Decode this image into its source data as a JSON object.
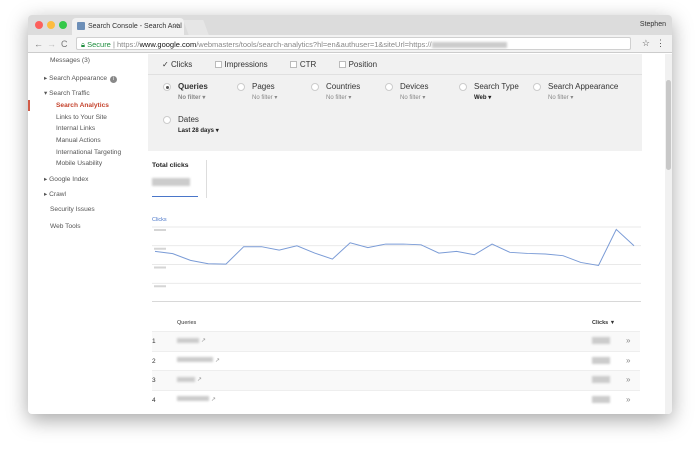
{
  "browser": {
    "tab_title": "Search Console - Search Anal",
    "user": "Stephen",
    "secure_label": "Secure",
    "url_prefix": "https://",
    "url_domain": "www.google.com",
    "url_path": "/webmasters/tools/search-analytics?hl=en&authuser=1&siteUrl=https://"
  },
  "sidebar": {
    "items": [
      {
        "label": "Messages (3)"
      },
      {
        "label": "Search Appearance"
      },
      {
        "label": "Search Traffic"
      },
      {
        "label": "Search Analytics"
      },
      {
        "label": "Links to Your Site"
      },
      {
        "label": "Internal Links"
      },
      {
        "label": "Manual Actions"
      },
      {
        "label": "International Targeting"
      },
      {
        "label": "Mobile Usability"
      },
      {
        "label": "Google Index"
      },
      {
        "label": "Crawl"
      },
      {
        "label": "Security Issues"
      },
      {
        "label": "Web Tools"
      }
    ],
    "active": "Search Analytics",
    "accent": "#c5442e"
  },
  "metrics": {
    "clicks": "Clicks",
    "impressions": "Impressions",
    "ctr": "CTR",
    "position": "Position",
    "clicks_checked": true
  },
  "dimensions": [
    {
      "label": "Queries",
      "filter": "No filter",
      "selected": true
    },
    {
      "label": "Pages",
      "filter": "No filter"
    },
    {
      "label": "Countries",
      "filter": "No filter"
    },
    {
      "label": "Devices",
      "filter": "No filter"
    },
    {
      "label": "Search Type",
      "filter": "Web"
    },
    {
      "label": "Search Appearance",
      "filter": "No filter"
    },
    {
      "label": "Dates",
      "filter": "Last 28 days"
    }
  ],
  "summary": {
    "total_label": "Total clicks"
  },
  "chart_data": {
    "type": "line",
    "title": "",
    "ylabel": "Clicks",
    "series": [
      {
        "name": "Clicks",
        "color": "#7a9bd6",
        "values": [
          2.7,
          2.58,
          2.22,
          2.04,
          2.02,
          2.95,
          2.95,
          2.77,
          3.0,
          2.61,
          2.29,
          3.16,
          2.9,
          3.09,
          3.09,
          3.05,
          2.61,
          2.7,
          2.52,
          3.09,
          2.65,
          2.59,
          2.56,
          2.47,
          2.11,
          1.95,
          3.87,
          3.0
        ]
      }
    ],
    "ylim": [
      0,
      4
    ],
    "grid": true,
    "note_ticks_blurred": true
  },
  "table": {
    "headers": {
      "queries": "Queries",
      "clicks": "Clicks ▼"
    },
    "rows": [
      {
        "rank": "1"
      },
      {
        "rank": "2"
      },
      {
        "rank": "3"
      },
      {
        "rank": "4"
      }
    ]
  }
}
